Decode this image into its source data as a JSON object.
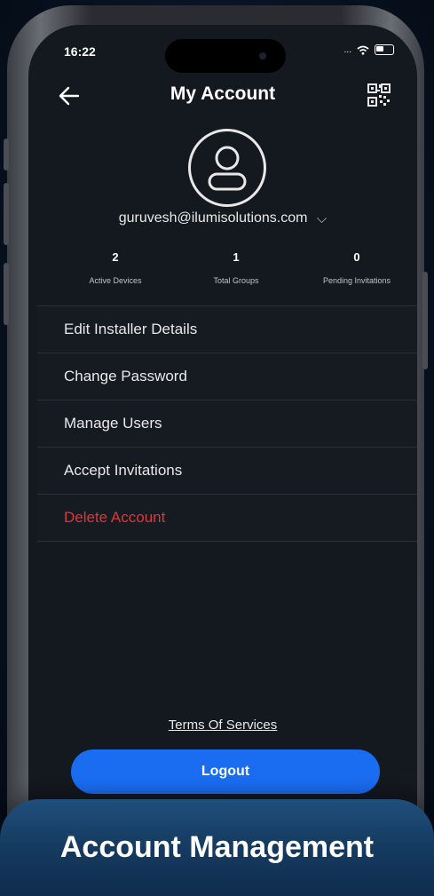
{
  "status_bar": {
    "time": "16:22",
    "signal_text": "..."
  },
  "header": {
    "title": "My Account",
    "back_icon": "arrow-left-icon",
    "qr_icon": "qr-code-icon"
  },
  "profile": {
    "avatar_icon": "user-avatar-icon",
    "email": "guruvesh@ilumisolutions.com",
    "dropdown_glyph": "⌵"
  },
  "stats": [
    {
      "value": "2",
      "label": "Active Devices"
    },
    {
      "value": "1",
      "label": "Total Groups"
    },
    {
      "value": "0",
      "label": "Pending Invitations"
    }
  ],
  "menu": [
    {
      "label": "Edit Installer Details"
    },
    {
      "label": "Change Password"
    },
    {
      "label": "Manage Users"
    },
    {
      "label": "Accept Invitations"
    },
    {
      "label": "Delete Account"
    }
  ],
  "footer": {
    "terms_label": "Terms Of Services",
    "logout_label": "Logout"
  },
  "banner": {
    "label": "Account Management"
  },
  "colors": {
    "accent": "#1a6cf0",
    "danger": "#e0353b",
    "screen_bg": "#14181f"
  }
}
